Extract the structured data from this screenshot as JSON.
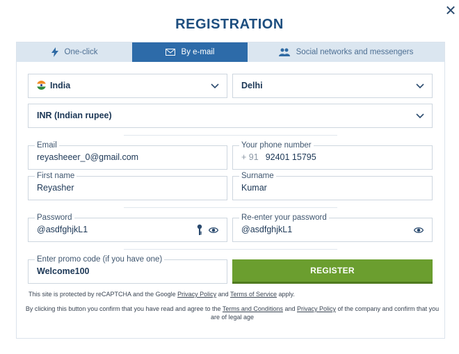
{
  "title": "REGISTRATION",
  "tabs": [
    {
      "label": "One-click"
    },
    {
      "label": "By e-mail"
    },
    {
      "label": "Social networks and messengers"
    }
  ],
  "country": {
    "value": "India"
  },
  "city": {
    "value": "Delhi"
  },
  "currency": {
    "value": "INR (Indian rupee)"
  },
  "email": {
    "label": "Email",
    "value": "reyasheeer_0@gmail.com"
  },
  "phone": {
    "label": "Your phone number",
    "prefix": "+ 91",
    "value": "92401 15795"
  },
  "first_name": {
    "label": "First name",
    "value": "Reyasher"
  },
  "surname": {
    "label": "Surname",
    "value": "Kumar"
  },
  "password": {
    "label": "Password",
    "value": "@asdfghjkL1"
  },
  "password_confirm": {
    "label": "Re-enter your password",
    "value": "@asdfghjkL1"
  },
  "promo": {
    "label": "Enter promo code (if you have one)",
    "value": "Welcome100"
  },
  "register_label": "REGISTER",
  "recaptcha": {
    "pre": "This site is protected by reCAPTCHA and the Google ",
    "privacy": "Privacy Policy",
    "and": " and ",
    "terms": "Terms of Service",
    "post": " apply."
  },
  "consent": {
    "pre": "By clicking this button you confirm that you have read and agree to the ",
    "terms": "Terms and Conditions",
    "and": " and ",
    "privacy": "Privacy Policy",
    "post": " of the company and confirm that you are of legal age"
  },
  "colors": {
    "primary": "#2d6ba9",
    "register": "#6b9e2f",
    "tab_bg": "#dbe6f0"
  }
}
